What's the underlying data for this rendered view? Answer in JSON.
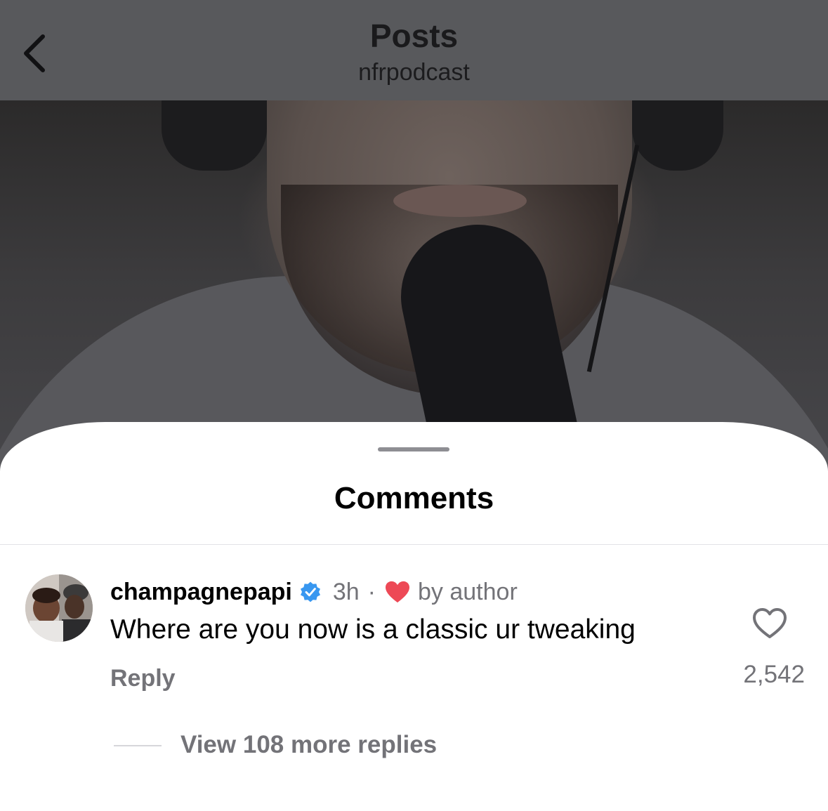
{
  "header": {
    "title": "Posts",
    "subtitle": "nfrpodcast",
    "back_icon": "chevron-left-icon"
  },
  "comments_sheet": {
    "title": "Comments"
  },
  "comment": {
    "username": "champagnepapi",
    "verified": true,
    "time": "3h",
    "separator": "·",
    "liked_by_author_label": "by author",
    "text": "Where are you now is a classic ur tweaking",
    "reply_label": "Reply",
    "like_count": "2,542",
    "view_replies_label": "View 108 more replies"
  },
  "colors": {
    "verified_badge": "#3897f0",
    "author_heart": "#ed4956",
    "muted_text": "#737378"
  }
}
